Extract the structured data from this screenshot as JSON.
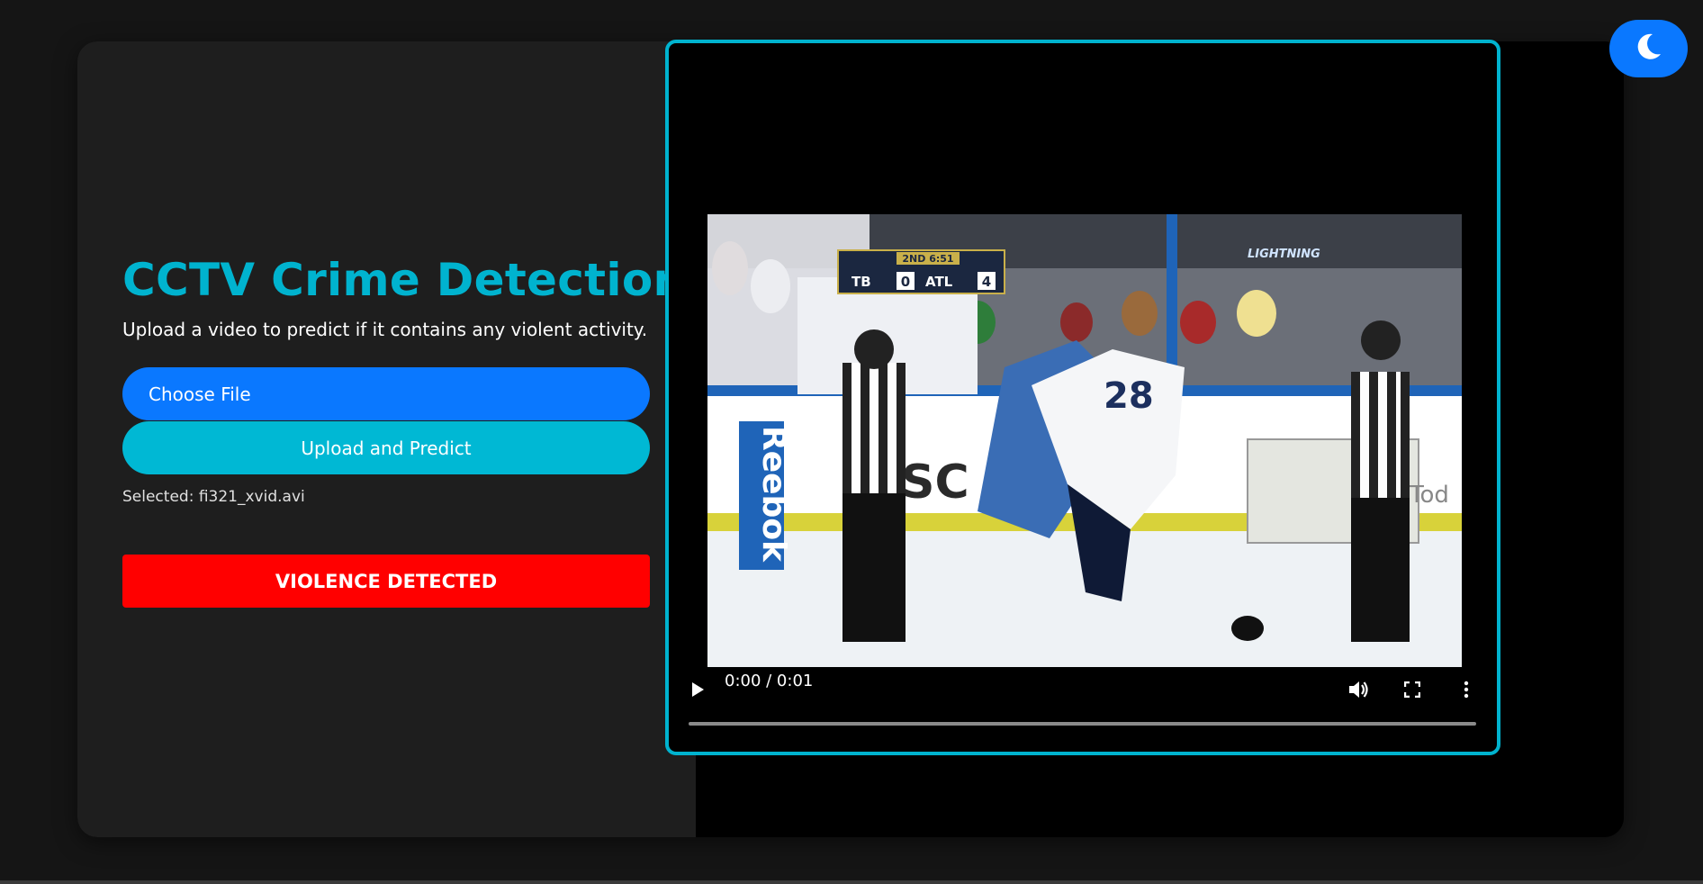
{
  "app": {
    "title": "CCTV Crime Detection",
    "subtitle": "Upload a video to predict if it contains any violent activity."
  },
  "upload": {
    "choose_label": "Choose File",
    "submit_label": "Upload and Predict",
    "selected_text": "Selected: fi321_xvid.avi"
  },
  "result": {
    "label": "VIOLENCE DETECTED",
    "color": "#ff0000"
  },
  "video": {
    "time_display": "0:00 / 0:01",
    "progress": 0,
    "frame_overlay": {
      "scoreboard_period": "2ND 6:51",
      "team_home": "TB",
      "score_home": "0",
      "team_away": "ATL",
      "score_away": "4",
      "broadcast_logo": "LIGHTNING",
      "board_text_left": "Reebok",
      "board_text_center": "SC",
      "board_text_right": "Tod",
      "jersey_number": "28"
    },
    "controls": {
      "play_icon": "play-icon",
      "volume_icon": "volume-icon",
      "fullscreen_icon": "fullscreen-icon",
      "more_icon": "more-options-icon"
    }
  },
  "theme": {
    "toggle_icon": "moon-icon",
    "accent": "#00b3cf",
    "primary": "#0a78ff"
  }
}
